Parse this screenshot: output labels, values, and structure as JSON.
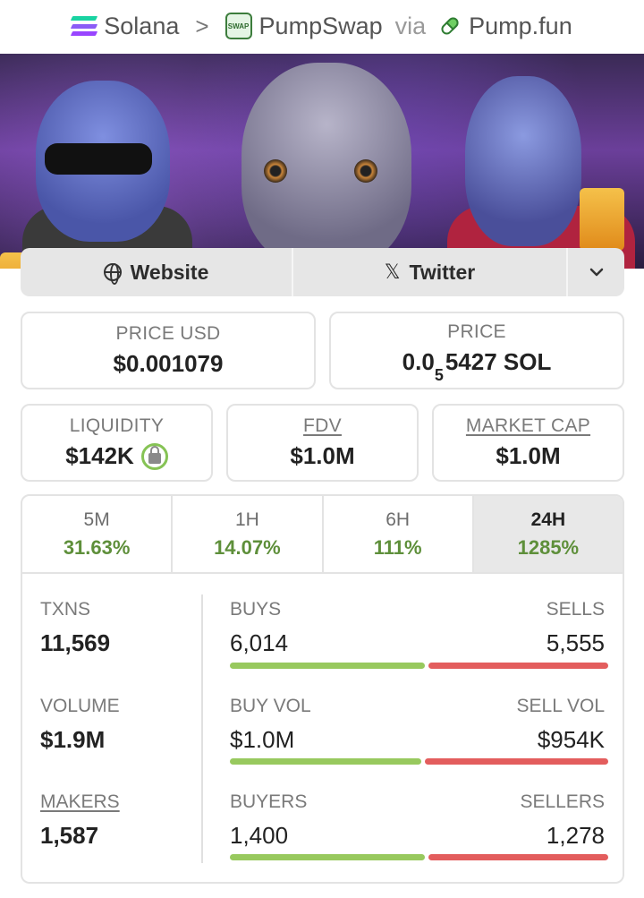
{
  "breadcrumb": {
    "chain": "Solana",
    "separator": ">",
    "dex": "PumpSwap",
    "dex_badge": "SWAP",
    "via": "via",
    "launchpad": "Pump.fun"
  },
  "links": {
    "website": "Website",
    "twitter": "Twitter",
    "more": "⌄"
  },
  "stats": {
    "price_usd": {
      "label": "PRICE USD",
      "value": "$0.001079"
    },
    "price": {
      "label": "PRICE",
      "value_prefix": "0.0",
      "value_sub": "5",
      "value_suffix": "5427 SOL"
    },
    "liquidity": {
      "label": "LIQUIDITY",
      "value": "$142K"
    },
    "fdv": {
      "label": "FDV",
      "value": "$1.0M"
    },
    "market_cap": {
      "label": "MARKET CAP",
      "value": "$1.0M"
    }
  },
  "timeframes": [
    {
      "label": "5M",
      "change": "31.63%"
    },
    {
      "label": "1H",
      "change": "14.07%"
    },
    {
      "label": "6H",
      "change": "111%"
    },
    {
      "label": "24H",
      "change": "1285%",
      "active": true
    }
  ],
  "txn": {
    "txns": {
      "label": "TXNS",
      "value": "11,569"
    },
    "buys": {
      "label": "BUYS",
      "value": "6,014"
    },
    "sells": {
      "label": "SELLS",
      "value": "5,555"
    },
    "volume": {
      "label": "VOLUME",
      "value": "$1.9M"
    },
    "buy_vol": {
      "label": "BUY VOL",
      "value": "$1.0M"
    },
    "sell_vol": {
      "label": "SELL VOL",
      "value": "$954K"
    },
    "makers": {
      "label": "MAKERS",
      "value": "1,587"
    },
    "buyers": {
      "label": "BUYERS",
      "value": "1,400"
    },
    "sellers": {
      "label": "SELLERS",
      "value": "1,278"
    }
  },
  "ratios": {
    "buys_fraction": 0.52,
    "buy_vol_fraction": 0.51,
    "buyers_fraction": 0.52
  },
  "colors": {
    "positive": "#5e8f3a",
    "buy_bar": "#98c95e",
    "sell_bar": "#e35d5d"
  }
}
